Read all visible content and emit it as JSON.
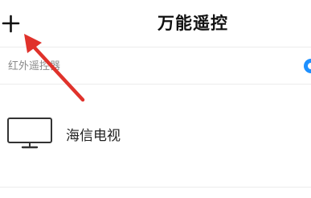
{
  "header": {
    "title": "万能遥控",
    "add_icon": "plus-icon"
  },
  "section": {
    "label": "红外遥控器",
    "toggle_color": "#1e90ff"
  },
  "devices": [
    {
      "name": "海信电视",
      "icon": "tv-icon"
    }
  ],
  "annotation": {
    "arrow_color": "#e0322b"
  }
}
